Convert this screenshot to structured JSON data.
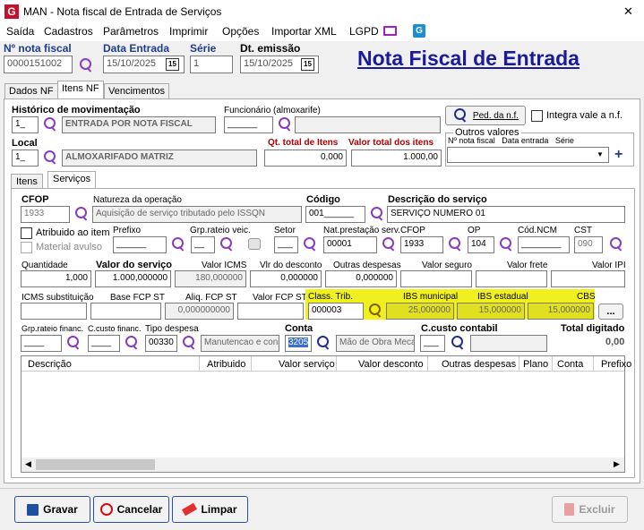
{
  "window": {
    "title": "MAN - Nota fiscal de Entrada de Serviços",
    "close": "✕"
  },
  "menu": [
    "Saída",
    "Cadastros",
    "Parâmetros",
    "Imprimir",
    "Opções",
    "Importar XML",
    "LGPD"
  ],
  "header": {
    "nota_label": "Nº nota fiscal",
    "nota_value": "0000151002",
    "data_entrada_label": "Data Entrada",
    "data_entrada": "15/10/2025",
    "serie_label": "Série",
    "serie": "1",
    "dt_emissao_label": "Dt. emissão",
    "dt_emissao": "15/10/2025",
    "big_title": "Nota Fiscal de Entrada",
    "cal": "15"
  },
  "tabs": [
    "Dados NF",
    "Itens NF",
    "Vencimentos"
  ],
  "top": {
    "historico_label": "Histórico de movimentação",
    "historico_code": "1_",
    "historico_desc": "ENTRADA POR NOTA FISCAL",
    "funcionario_label": "Funcionário (almoxarife)",
    "funcionario_code": "______",
    "ped_label": "Ped. da n.f.",
    "integra_label": "Integra vale a n.f.",
    "local_label": "Local",
    "local_code": "1_",
    "local_desc": "ALMOXARIFADO MATRIZ",
    "qt_label": "Qt. total de Itens",
    "qt_value": "0,000",
    "valor_total_label": "Valor total dos itens",
    "valor_total": "1.000,00",
    "outros_label": "Outros valores",
    "outros_cols": "Nº nota fiscal   Data entrada   Série",
    "plus": "+"
  },
  "subtabs": [
    "Itens",
    "Serviços"
  ],
  "svc": {
    "cfop_label": "CFOP",
    "cfop": "1933",
    "natureza_label": "Natureza da operação",
    "natureza": "Aquisição de serviço tributado pelo ISSQN",
    "codigo_label": "Código",
    "codigo": "001______",
    "descricao_label": "Descrição do serviço",
    "descricao": "SERVIÇO NUMERO 01",
    "atribuido_label": "Atribuido ao item",
    "material_label": "Material avulso",
    "prefixo_label": "Prefixo",
    "prefixo": "______",
    "grp_label": "Grp.rateio veic.",
    "grp": "__",
    "setor_label": "Setor",
    "setor": "___",
    "natprest_label": "Nat.prestação serv.",
    "natprest": "00001",
    "cfop2_label": "CFOP",
    "cfop2": "1933",
    "op_label": "OP",
    "op": "104",
    "ncm_label": "Cód.NCM",
    "ncm": "________",
    "cst_label": "CST",
    "cst": "090",
    "quantidade_label": "Quantidade",
    "quantidade": "1,000",
    "valor_servico_label": "Valor do serviço",
    "valor_servico": "1.000,000000",
    "valor_icms_label": "Valor ICMS",
    "valor_icms": "180,000000",
    "vlr_desconto_label": "Vlr do desconto",
    "vlr_desconto": "0,000000",
    "outras_label": "Outras despesas",
    "outras": "0,000000",
    "seguro_label": "Valor seguro",
    "frete_label": "Valor frete",
    "ipi_label": "Valor IPI",
    "icms_st_label": "ICMS substituição",
    "base_fcp_label": "Base FCP ST",
    "aliq_fcp_label": "Aliq. FCP ST",
    "aliq_fcp": "0,000000000",
    "valor_fcp_label": "Valor FCP ST",
    "class_trib_label": "Class. Trib.",
    "class_trib": "000003",
    "ibs_mun_label": "IBS municipal",
    "ibs_mun": "25,000000",
    "ibs_est_label": "IBS estadual",
    "ibs_est": "15,000000",
    "cbs_label": "CBS",
    "cbs": "15,000000",
    "more": "...",
    "grp_fin_label": "Grp.rateio financ.",
    "grp_fin": "____",
    "ccusto_label": "C.custo financ.",
    "ccusto": "____",
    "tipo_despesa_label": "Tipo despesa",
    "tipo_despesa": "00330",
    "tipo_desc": "Manutencao e cons",
    "conta_label": "Conta",
    "conta": "3205",
    "conta_desc": "Mão de Obra Mecan",
    "ccont_label": "C.custo contabil",
    "ccont": "___",
    "total_label": "Total digitado",
    "total": "0,00"
  },
  "grid": {
    "headers": [
      "Descrição",
      "Atribuido",
      "Valor serviço",
      "Valor desconto",
      "Outras despesas",
      "Plano",
      "Conta",
      "Prefixo"
    ]
  },
  "footer": {
    "gravar": "Gravar",
    "cancelar": "Cancelar",
    "limpar": "Limpar",
    "excluir": "Excluir"
  }
}
